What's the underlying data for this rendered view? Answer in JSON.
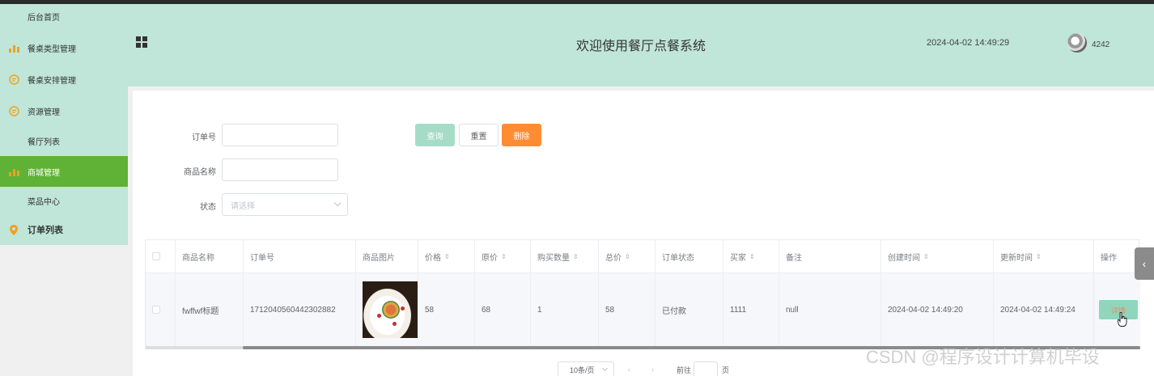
{
  "sidebar": {
    "items": [
      {
        "label": "后台首页",
        "icon": "none"
      },
      {
        "label": "餐桌类型管理",
        "icon": "bar-chart-icon"
      },
      {
        "label": "餐桌安排管理",
        "icon": "chat-icon"
      },
      {
        "label": "资源管理",
        "icon": "chat-icon"
      },
      {
        "label": "餐厅列表",
        "icon": "none"
      },
      {
        "label": "商城管理",
        "icon": "bar-chart-icon"
      },
      {
        "label": "菜品中心",
        "icon": "none"
      },
      {
        "label": "订单列表",
        "icon": "location-pin-icon"
      }
    ],
    "active_index": 5,
    "accent": "#5fb236",
    "icon_color": "#f0a020"
  },
  "header": {
    "title": "欢迎使用餐厅点餐系统",
    "datetime": "2024-04-02 14:49:29",
    "username": "4242",
    "background": "#bfe6d8"
  },
  "search": {
    "order_no_label": "订单号",
    "product_name_label": "商品名称",
    "status_label": "状态",
    "status_placeholder": "请选择",
    "search_button": "查询",
    "reset_button": "重置",
    "delete_button": "删除"
  },
  "table": {
    "columns": [
      {
        "label": "",
        "sortable": false
      },
      {
        "label": "商品名称",
        "sortable": false
      },
      {
        "label": "订单号",
        "sortable": false
      },
      {
        "label": "商品图片",
        "sortable": false
      },
      {
        "label": "价格",
        "sortable": true
      },
      {
        "label": "原价",
        "sortable": true
      },
      {
        "label": "购买数量",
        "sortable": true
      },
      {
        "label": "总价",
        "sortable": true
      },
      {
        "label": "订单状态",
        "sortable": false
      },
      {
        "label": "买家",
        "sortable": true
      },
      {
        "label": "备注",
        "sortable": false
      },
      {
        "label": "创建时间",
        "sortable": true
      },
      {
        "label": "更新时间",
        "sortable": true
      },
      {
        "label": "操作",
        "sortable": false
      }
    ],
    "rows": [
      {
        "product_name": "fwffwf标题",
        "order_no": "1712040560442302882",
        "price": "58",
        "original_price": "68",
        "quantity": "1",
        "total": "58",
        "status": "已付款",
        "buyer": "1111",
        "note": "null",
        "created_at": "2024-04-02 14:49:20",
        "updated_at": "2024-04-02 14:49:24",
        "action": "详情"
      }
    ]
  },
  "pagination": {
    "page_size": "10条/页",
    "prev": "‹",
    "next": "›",
    "goto_label": "前往",
    "page_suffix": "页"
  },
  "sidetab_icon": "‹",
  "watermark": "CSDN @程序设计计算机毕设"
}
